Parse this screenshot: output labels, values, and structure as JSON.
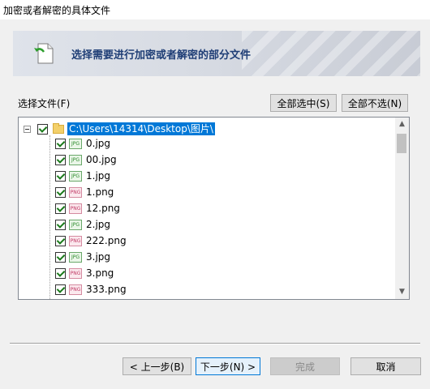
{
  "window": {
    "title": "加密或者解密的具体文件"
  },
  "banner": {
    "text": "选择需要进行加密或者解密的部分文件",
    "icon": "document-back-icon"
  },
  "file_section": {
    "label": "选择文件(F)",
    "select_all": "全部选中(S)",
    "deselect_all": "全部不选(N)"
  },
  "tree": {
    "root": {
      "path": "C:\\Users\\14314\\Desktop\\图片\\",
      "checked": true,
      "expanded": true
    },
    "items": [
      {
        "name": "0.jpg",
        "type": "jpg",
        "checked": true
      },
      {
        "name": "00.jpg",
        "type": "jpg",
        "checked": true
      },
      {
        "name": "1.jpg",
        "type": "jpg",
        "checked": true
      },
      {
        "name": "1.png",
        "type": "png",
        "checked": true
      },
      {
        "name": "12.png",
        "type": "png",
        "checked": true
      },
      {
        "name": "2.jpg",
        "type": "jpg",
        "checked": true
      },
      {
        "name": "222.png",
        "type": "png",
        "checked": true
      },
      {
        "name": "3.jpg",
        "type": "jpg",
        "checked": true
      },
      {
        "name": "3.png",
        "type": "png",
        "checked": true
      },
      {
        "name": "333.png",
        "type": "png",
        "checked": true
      }
    ]
  },
  "footer": {
    "back": "< 上一步(B)",
    "next": "下一步(N) >",
    "finish": "完成",
    "cancel": "取消"
  },
  "colors": {
    "accent": "#0078d7",
    "banner_text": "#1f3e76"
  }
}
